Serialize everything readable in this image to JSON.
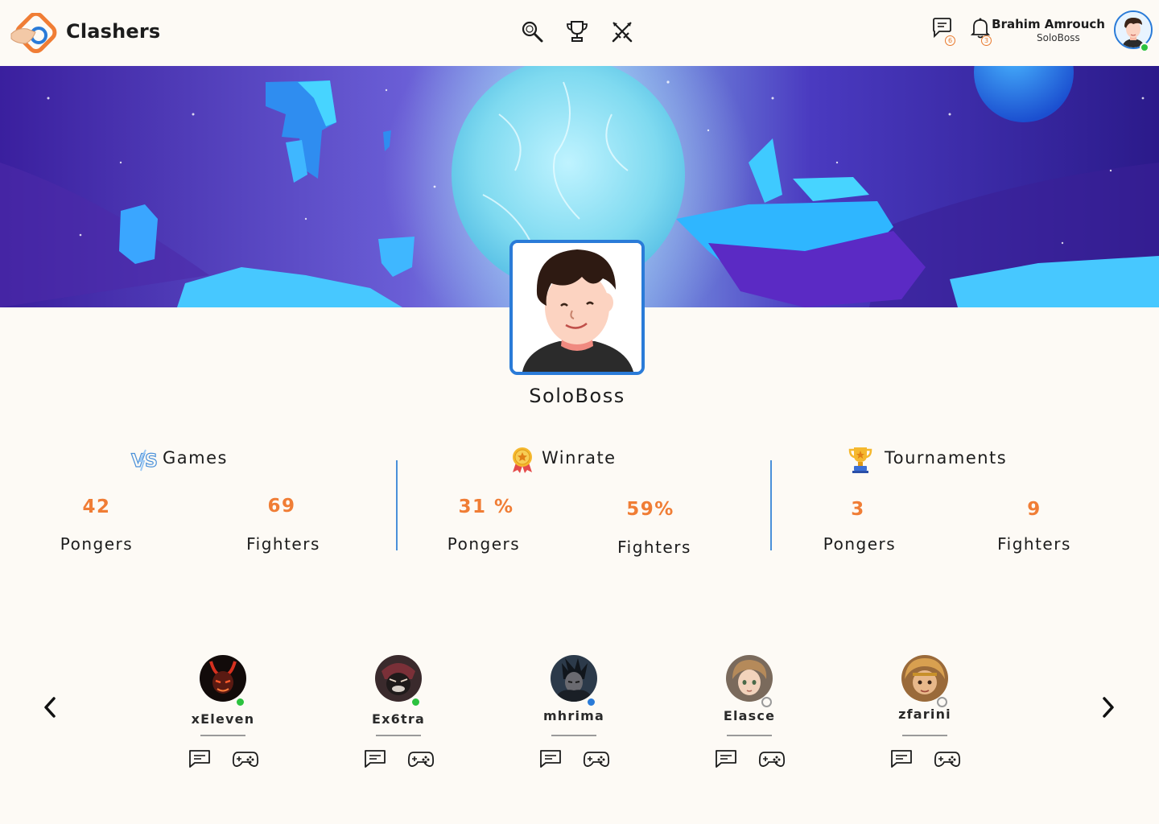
{
  "app": {
    "brand": "Clashers"
  },
  "header": {
    "nav": [
      {
        "name": "search-icon"
      },
      {
        "name": "trophy-icon"
      },
      {
        "name": "crossed-swords-icon"
      }
    ],
    "messages_badge": "6",
    "notifications_badge": "3",
    "user": {
      "name": "Brahim Amrouch",
      "handle": "SoloBoss",
      "status": "online"
    }
  },
  "profile": {
    "username": "SoloBoss"
  },
  "stats": {
    "games": {
      "title": "Games",
      "pongers": "42",
      "fighters": "69",
      "pongers_label": "Pongers",
      "fighters_label": "Fighters"
    },
    "winrate": {
      "title": "Winrate",
      "pongers": "31 %",
      "fighters": "59%",
      "pongers_label": "Pongers",
      "fighters_label": "Fighters"
    },
    "tournaments": {
      "title": "Tournaments",
      "pongers": "3",
      "fighters": "9",
      "pongers_label": "Pongers",
      "fighters_label": "Fighters"
    }
  },
  "friends": [
    {
      "name": "xEleven",
      "status": "online",
      "status_color": "#2cc23f"
    },
    {
      "name": "Ex6tra",
      "status": "online",
      "status_color": "#2cc23f"
    },
    {
      "name": "mhrima",
      "status": "in-game",
      "status_color": "#2a7bd8"
    },
    {
      "name": "Elasce",
      "status": "offline",
      "status_color": "#9a9a9a"
    },
    {
      "name": "zfarini",
      "status": "offline",
      "status_color": "#9a9a9a"
    }
  ],
  "colors": {
    "accent": "#f07d35",
    "brand_blue": "#2a7bd8",
    "online": "#2cc23f",
    "background": "#fdfaf5"
  }
}
